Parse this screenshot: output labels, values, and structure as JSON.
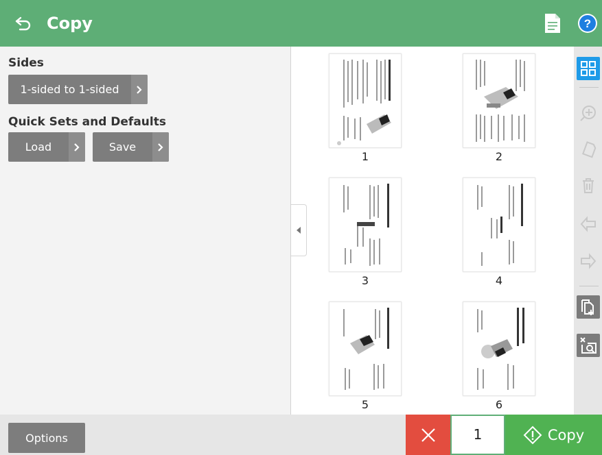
{
  "header": {
    "title": "Copy",
    "icons": [
      "back-arrow-icon",
      "document-icon",
      "help-icon"
    ]
  },
  "sides": {
    "label": "Sides",
    "value": "1-sided to 1-sided"
  },
  "quick_sets": {
    "label": "Quick Sets and Defaults",
    "load": "Load",
    "save": "Save"
  },
  "pages": [
    {
      "number": "1"
    },
    {
      "number": "2"
    },
    {
      "number": "3"
    },
    {
      "number": "4"
    },
    {
      "number": "5"
    },
    {
      "number": "6"
    }
  ],
  "toolbar": {
    "icons": [
      "grid-view-icon",
      "zoom-in-icon",
      "rotate-icon",
      "delete-icon",
      "move-left-icon",
      "move-right-icon",
      "add-pages-icon",
      "clear-preview-icon"
    ],
    "active": "grid-view-icon"
  },
  "bottom": {
    "options": "Options",
    "copies": "1",
    "copy": "Copy"
  },
  "colors": {
    "header": "#5eae76",
    "button": "#7d7d7d",
    "cancel": "#e34d3f",
    "copy": "#50b252",
    "active": "#1f9be8"
  }
}
